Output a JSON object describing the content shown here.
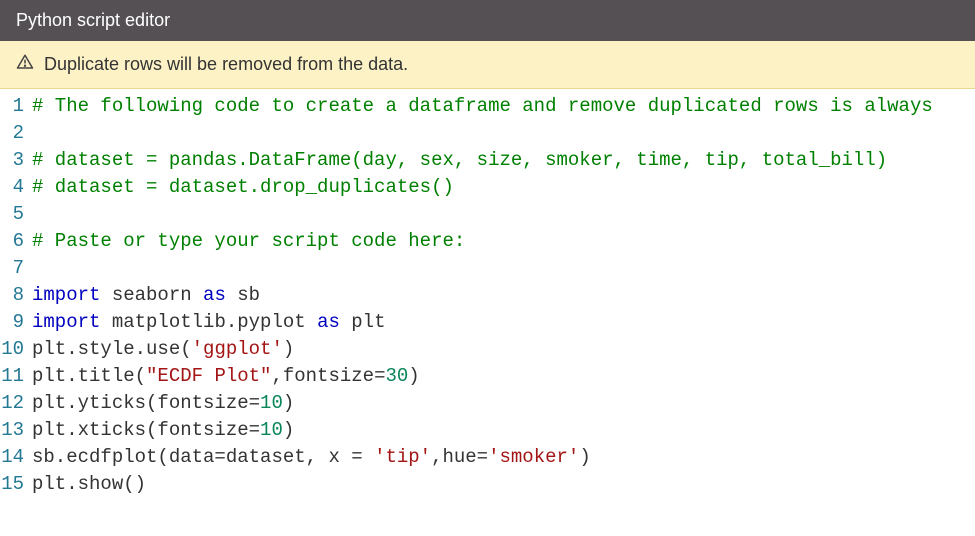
{
  "titlebar": {
    "title": "Python script editor"
  },
  "warning": {
    "icon_name": "warning-triangle-icon",
    "message": "Duplicate rows will be removed from the data."
  },
  "editor": {
    "lines": [
      {
        "n": 1,
        "tokens": [
          {
            "t": "# The following code to create a dataframe and remove duplicated rows is always",
            "c": "comment"
          }
        ]
      },
      {
        "n": 2,
        "tokens": []
      },
      {
        "n": 3,
        "tokens": [
          {
            "t": "# dataset = pandas.DataFrame(day, sex, size, smoker, time, tip, total_bill)",
            "c": "comment"
          }
        ]
      },
      {
        "n": 4,
        "tokens": [
          {
            "t": "# dataset = dataset.drop_duplicates()",
            "c": "comment"
          }
        ]
      },
      {
        "n": 5,
        "tokens": []
      },
      {
        "n": 6,
        "tokens": [
          {
            "t": "# Paste or type your script code here:",
            "c": "comment"
          }
        ]
      },
      {
        "n": 7,
        "tokens": []
      },
      {
        "n": 8,
        "tokens": [
          {
            "t": "import",
            "c": "keyword"
          },
          {
            "t": " seaborn ",
            "c": "ident"
          },
          {
            "t": "as",
            "c": "keyword"
          },
          {
            "t": " sb",
            "c": "ident"
          }
        ]
      },
      {
        "n": 9,
        "tokens": [
          {
            "t": "import",
            "c": "keyword"
          },
          {
            "t": " matplotlib.pyplot ",
            "c": "ident"
          },
          {
            "t": "as",
            "c": "keyword"
          },
          {
            "t": " plt",
            "c": "ident"
          }
        ]
      },
      {
        "n": 10,
        "tokens": [
          {
            "t": "plt.style.use(",
            "c": "ident"
          },
          {
            "t": "'ggplot'",
            "c": "string"
          },
          {
            "t": ")",
            "c": "ident"
          }
        ]
      },
      {
        "n": 11,
        "tokens": [
          {
            "t": "plt.title(",
            "c": "ident"
          },
          {
            "t": "\"ECDF Plot\"",
            "c": "string"
          },
          {
            "t": ",fontsize=",
            "c": "ident"
          },
          {
            "t": "30",
            "c": "number"
          },
          {
            "t": ")",
            "c": "ident"
          }
        ]
      },
      {
        "n": 12,
        "tokens": [
          {
            "t": "plt.yticks(fontsize=",
            "c": "ident"
          },
          {
            "t": "10",
            "c": "number"
          },
          {
            "t": ")",
            "c": "ident"
          }
        ]
      },
      {
        "n": 13,
        "tokens": [
          {
            "t": "plt.xticks(fontsize=",
            "c": "ident"
          },
          {
            "t": "10",
            "c": "number"
          },
          {
            "t": ")",
            "c": "ident"
          }
        ]
      },
      {
        "n": 14,
        "tokens": [
          {
            "t": "sb.ecdfplot(data=dataset, x = ",
            "c": "ident"
          },
          {
            "t": "'tip'",
            "c": "string"
          },
          {
            "t": ",hue=",
            "c": "ident"
          },
          {
            "t": "'smoker'",
            "c": "string"
          },
          {
            "t": ")",
            "c": "ident"
          }
        ]
      },
      {
        "n": 15,
        "tokens": [
          {
            "t": "plt.show()",
            "c": "ident"
          }
        ]
      }
    ]
  }
}
